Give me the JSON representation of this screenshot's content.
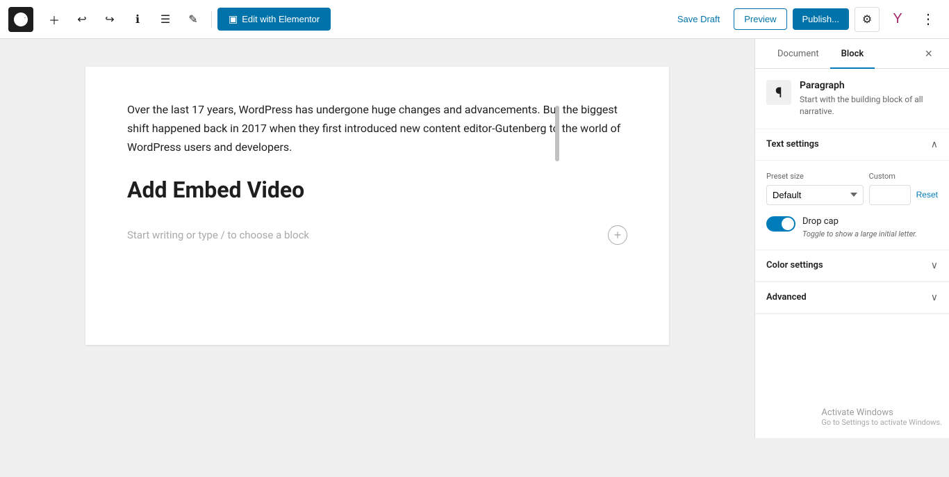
{
  "toolbar": {
    "wp_logo_title": "WordPress",
    "add_block_label": "+",
    "undo_label": "↩",
    "redo_label": "↪",
    "info_label": "ℹ",
    "list_view_label": "≡",
    "tools_label": "✎",
    "edit_elementor_label": "Edit with Elementor",
    "save_draft_label": "Save Draft",
    "preview_label": "Preview",
    "publish_label": "Publish...",
    "gear_label": "⚙",
    "more_label": "⋮"
  },
  "editor": {
    "paragraph_text": "Over the last 17 years, WordPress has undergone huge changes and advancements. But the biggest shift happened back in 2017 when they first introduced new content editor-Gutenberg to the world of WordPress users and developers.",
    "heading_text": "Add Embed Video",
    "placeholder_text": "Start writing or type / to choose a block"
  },
  "sidebar": {
    "tab_document_label": "Document",
    "tab_block_label": "Block",
    "close_label": "×",
    "block_icon": "¶",
    "block_name": "Paragraph",
    "block_desc": "Start with the building block of all narrative.",
    "text_settings_title": "Text settings",
    "preset_label": "Preset size",
    "custom_label": "Custom",
    "preset_default": "Default",
    "reset_label": "Reset",
    "drop_cap_label": "Drop cap",
    "drop_cap_hint": "Toggle to show a large initial letter.",
    "color_settings_title": "Color settings",
    "advanced_title": "Advanced"
  },
  "activate_windows": {
    "title": "Activate Windows",
    "subtitle": "Go to Settings to activate Windows."
  }
}
